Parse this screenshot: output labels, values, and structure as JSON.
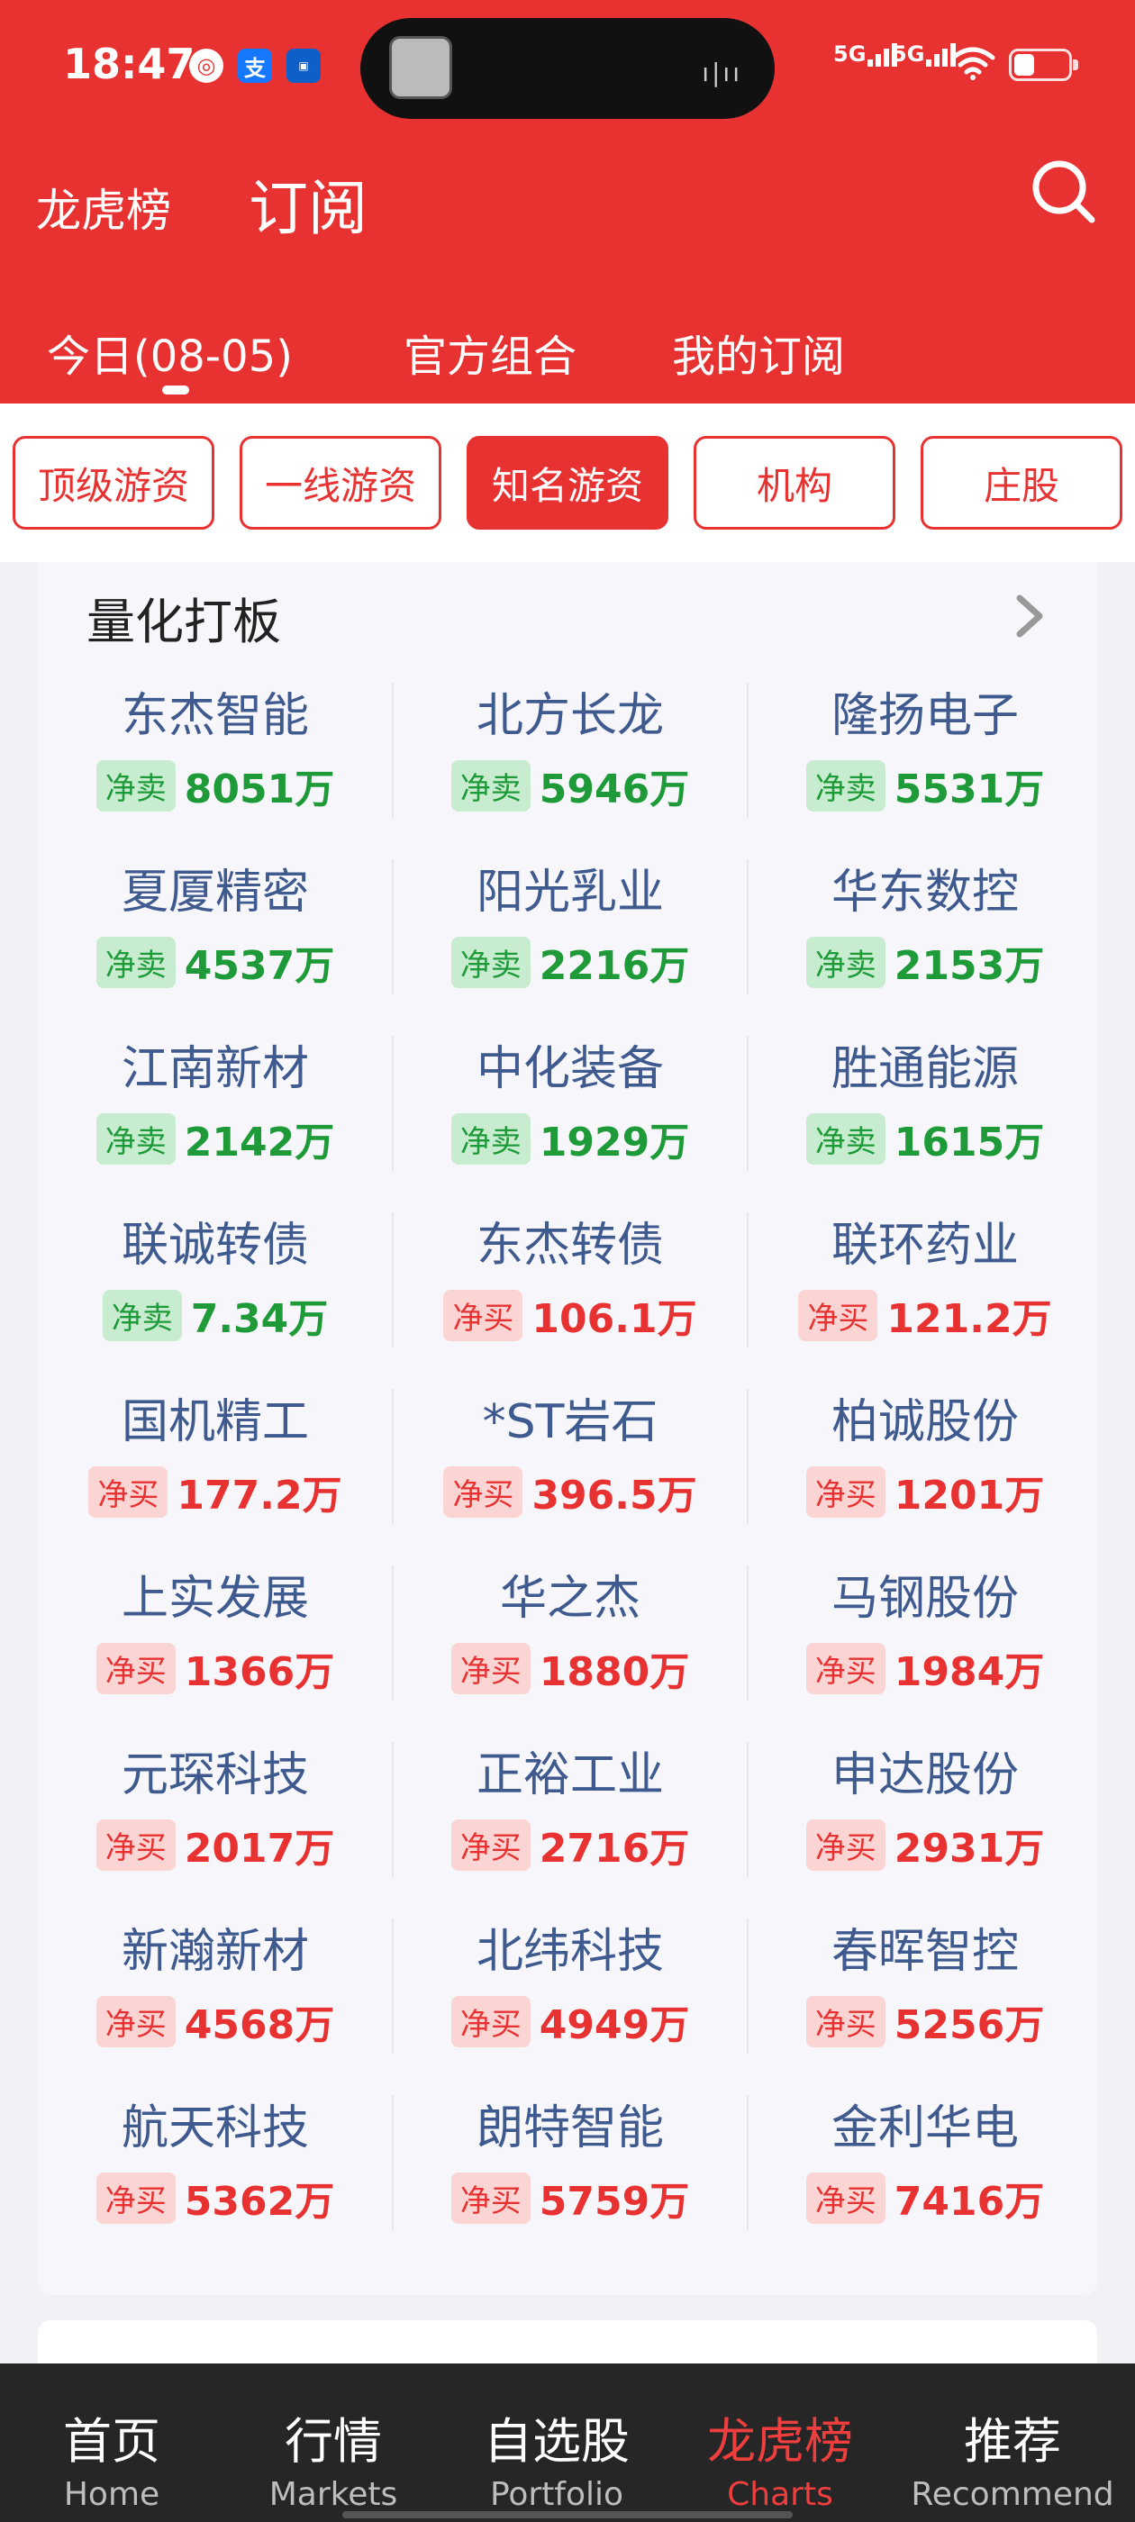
{
  "status_bar": {
    "time": "18:47",
    "apps": [
      "netease-icon",
      "alipay-icon",
      "car-app-icon"
    ],
    "alipay_label": "支",
    "signal1": "5G",
    "signal2": "5G"
  },
  "header": {
    "title": "龙虎榜",
    "subtitle": "订阅",
    "tabs": [
      {
        "label": "今日(08-05)"
      },
      {
        "label": "官方组合"
      },
      {
        "label": "我的订阅"
      }
    ]
  },
  "filters": [
    {
      "label": "顶级游资",
      "active": false
    },
    {
      "label": "一线游资",
      "active": false
    },
    {
      "label": "知名游资",
      "active": true
    },
    {
      "label": "机构",
      "active": false
    },
    {
      "label": "庄股",
      "active": false
    }
  ],
  "section": {
    "title": "量化打板",
    "items": [
      {
        "name": "东杰智能",
        "tag": "净卖",
        "value": "8051万",
        "type": "sell"
      },
      {
        "name": "北方长龙",
        "tag": "净卖",
        "value": "5946万",
        "type": "sell"
      },
      {
        "name": "隆扬电子",
        "tag": "净卖",
        "value": "5531万",
        "type": "sell"
      },
      {
        "name": "夏厦精密",
        "tag": "净卖",
        "value": "4537万",
        "type": "sell"
      },
      {
        "name": "阳光乳业",
        "tag": "净卖",
        "value": "2216万",
        "type": "sell"
      },
      {
        "name": "华东数控",
        "tag": "净卖",
        "value": "2153万",
        "type": "sell"
      },
      {
        "name": "江南新材",
        "tag": "净卖",
        "value": "2142万",
        "type": "sell"
      },
      {
        "name": "中化装备",
        "tag": "净卖",
        "value": "1929万",
        "type": "sell"
      },
      {
        "name": "胜通能源",
        "tag": "净卖",
        "value": "1615万",
        "type": "sell"
      },
      {
        "name": "联诚转债",
        "tag": "净卖",
        "value": "7.34万",
        "type": "sell"
      },
      {
        "name": "东杰转债",
        "tag": "净买",
        "value": "106.1万",
        "type": "buy"
      },
      {
        "name": "联环药业",
        "tag": "净买",
        "value": "121.2万",
        "type": "buy"
      },
      {
        "name": "国机精工",
        "tag": "净买",
        "value": "177.2万",
        "type": "buy"
      },
      {
        "name": "*ST岩石",
        "tag": "净买",
        "value": "396.5万",
        "type": "buy"
      },
      {
        "name": "柏诚股份",
        "tag": "净买",
        "value": "1201万",
        "type": "buy"
      },
      {
        "name": "上实发展",
        "tag": "净买",
        "value": "1366万",
        "type": "buy"
      },
      {
        "name": "华之杰",
        "tag": "净买",
        "value": "1880万",
        "type": "buy"
      },
      {
        "name": "马钢股份",
        "tag": "净买",
        "value": "1984万",
        "type": "buy"
      },
      {
        "name": "元琛科技",
        "tag": "净买",
        "value": "2017万",
        "type": "buy"
      },
      {
        "name": "正裕工业",
        "tag": "净买",
        "value": "2716万",
        "type": "buy"
      },
      {
        "name": "申达股份",
        "tag": "净买",
        "value": "2931万",
        "type": "buy"
      },
      {
        "name": "新瀚新材",
        "tag": "净买",
        "value": "4568万",
        "type": "buy"
      },
      {
        "name": "北纬科技",
        "tag": "净买",
        "value": "4949万",
        "type": "buy"
      },
      {
        "name": "春晖智控",
        "tag": "净买",
        "value": "5256万",
        "type": "buy"
      },
      {
        "name": "航天科技",
        "tag": "净买",
        "value": "5362万",
        "type": "buy"
      },
      {
        "name": "朗特智能",
        "tag": "净买",
        "value": "5759万",
        "type": "buy"
      },
      {
        "name": "金利华电",
        "tag": "净买",
        "value": "7416万",
        "type": "buy"
      }
    ]
  },
  "bottom_nav": [
    {
      "zh": "首页",
      "en": "Home",
      "active": false
    },
    {
      "zh": "行情",
      "en": "Markets",
      "active": false
    },
    {
      "zh": "自选股",
      "en": "Portfolio",
      "active": false
    },
    {
      "zh": "龙虎榜",
      "en": "Charts",
      "active": true
    },
    {
      "zh": "推荐",
      "en": "Recommend",
      "active": false
    }
  ],
  "colors": {
    "brand_red": "#e83232",
    "sell_green": "#1e9a38",
    "buy_red": "#e83232",
    "stock_name_blue": "#3f5a8e"
  }
}
